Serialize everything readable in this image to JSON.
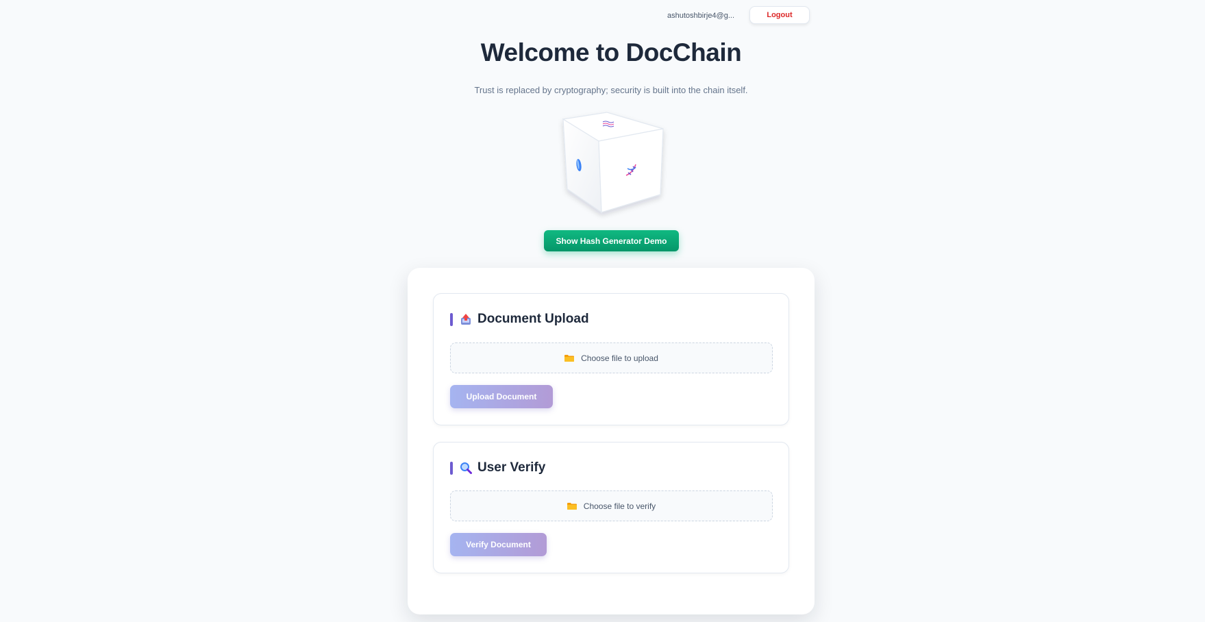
{
  "header": {
    "user_email": "ashutoshbirje4@g...",
    "logout_label": "Logout"
  },
  "hero": {
    "title": "Welcome to DocChain",
    "tagline": "Trust is replaced by cryptography; security is built into the chain itself.",
    "cube_faces": [
      "leaf-icon",
      "dna-icon",
      "wave-icon"
    ],
    "demo_button_label": "Show Hash Generator Demo"
  },
  "upload": {
    "icon": "upload-tray-icon",
    "title": "Document Upload",
    "file_placeholder": "Choose file to upload",
    "button_label": "Upload Document"
  },
  "verify": {
    "icon": "magnifier-icon",
    "title": "User Verify",
    "file_placeholder": "Choose file to verify",
    "button_label": "Verify Document"
  },
  "colors": {
    "accent": "#6d5bd0",
    "demo_button": "#10b981",
    "logout_text": "#dc2626",
    "action_button_start": "#a5b4f0",
    "action_button_end": "#b29bd6"
  }
}
